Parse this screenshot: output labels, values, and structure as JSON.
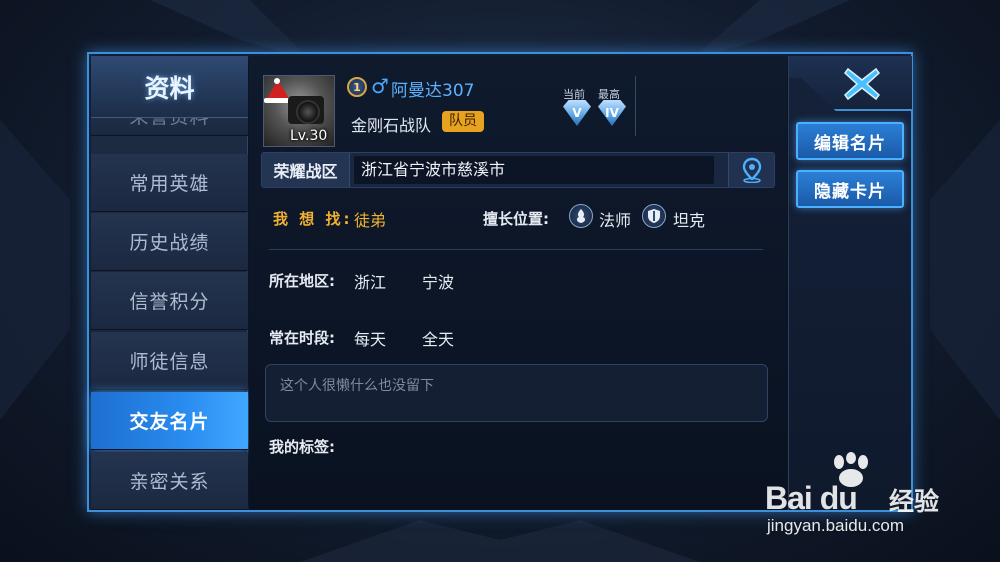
{
  "sidebar": {
    "title": "资料",
    "items": [
      {
        "label": "荣誉资料"
      },
      {
        "label": "常用英雄"
      },
      {
        "label": "历史战绩"
      },
      {
        "label": "信誉积分"
      },
      {
        "label": "师徒信息"
      },
      {
        "label": "交友名片"
      },
      {
        "label": "亲密关系"
      }
    ],
    "active_index": 5
  },
  "profile": {
    "level": "Lv.30",
    "rank_number": "1",
    "gender_symbol": "♂",
    "name": "阿曼达307",
    "team": "金刚石战队",
    "team_role": "队员",
    "rank_current_label": "当前",
    "rank_current_tier": "V",
    "rank_best_label": "最高",
    "rank_best_tier": "IV"
  },
  "server": {
    "label": "荣耀战区",
    "value": "浙江省宁波市慈溪市"
  },
  "card": {
    "seek_label": "我 想 找:",
    "seek_value": "徒弟",
    "position_label": "擅长位置:",
    "positions": [
      {
        "name": "法师",
        "icon": "mage-icon"
      },
      {
        "name": "坦克",
        "icon": "tank-icon"
      }
    ],
    "region_label": "所在地区:",
    "region_province": "浙江",
    "region_city": "宁波",
    "time_label": "常在时段:",
    "time_days": "每天",
    "time_range": "全天",
    "signature_placeholder": "这个人很懒什么也没留下",
    "tags_label": "我的标签:"
  },
  "actions": {
    "edit_card": "编辑名片",
    "hide_card": "隐藏卡片"
  },
  "watermark": {
    "logo": "Bai du",
    "cn": "经验",
    "url": "jingyan.baidu.com"
  },
  "colors": {
    "accent_blue": "#3d8fd6",
    "active_tab": "#2a8cf0",
    "seek_orange": "#f0b030",
    "team_badge": "#e7a21f"
  }
}
